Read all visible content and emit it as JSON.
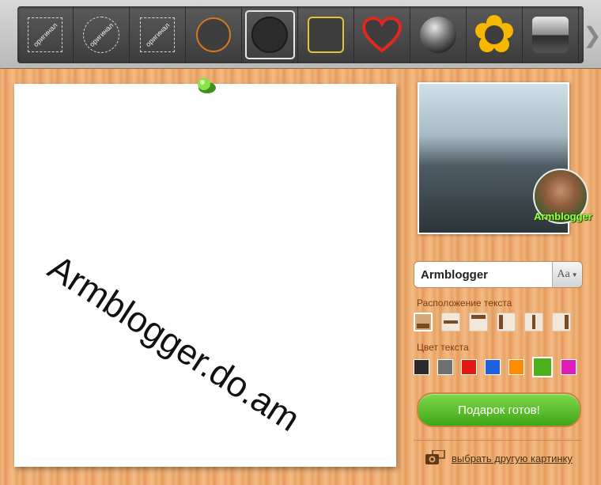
{
  "toolbar": {
    "frames": [
      {
        "icon": "square-dashed-frame-icon",
        "label": "оригинал",
        "selected": false
      },
      {
        "icon": "circle-dashed-frame-icon",
        "label": "оригинал",
        "selected": false
      },
      {
        "icon": "square-dashed-frame-icon",
        "label": "оригинал",
        "selected": false
      },
      {
        "icon": "circle-orange-frame-icon",
        "selected": false
      },
      {
        "icon": "circle-dark-frame-icon",
        "selected": true
      },
      {
        "icon": "square-yellow-frame-icon",
        "selected": false
      },
      {
        "icon": "heart-frame-icon",
        "selected": false
      },
      {
        "icon": "glossy-ball-frame-icon",
        "selected": false
      },
      {
        "icon": "flower-frame-icon",
        "selected": false
      },
      {
        "icon": "glossy-square-frame-icon",
        "selected": false
      }
    ],
    "next_icon": "chevron-right-icon"
  },
  "canvas": {
    "text": "Armblogger.do.am"
  },
  "preview": {
    "label": "Armblogger"
  },
  "editor": {
    "text_value": "Armblogger",
    "font_button_label": "Aa",
    "position_label": "Расположение текста",
    "color_label": "Цвет текста",
    "colors": [
      "#2b2b2b",
      "#6f6f6f",
      "#e21a12",
      "#1f5fe0",
      "#ff8a00",
      "#4bb21b",
      "#e01ab8"
    ],
    "active_color": "#4bb21b",
    "ready_button": "Подарок готов!",
    "choose_link": "выбрать другую картинку"
  }
}
